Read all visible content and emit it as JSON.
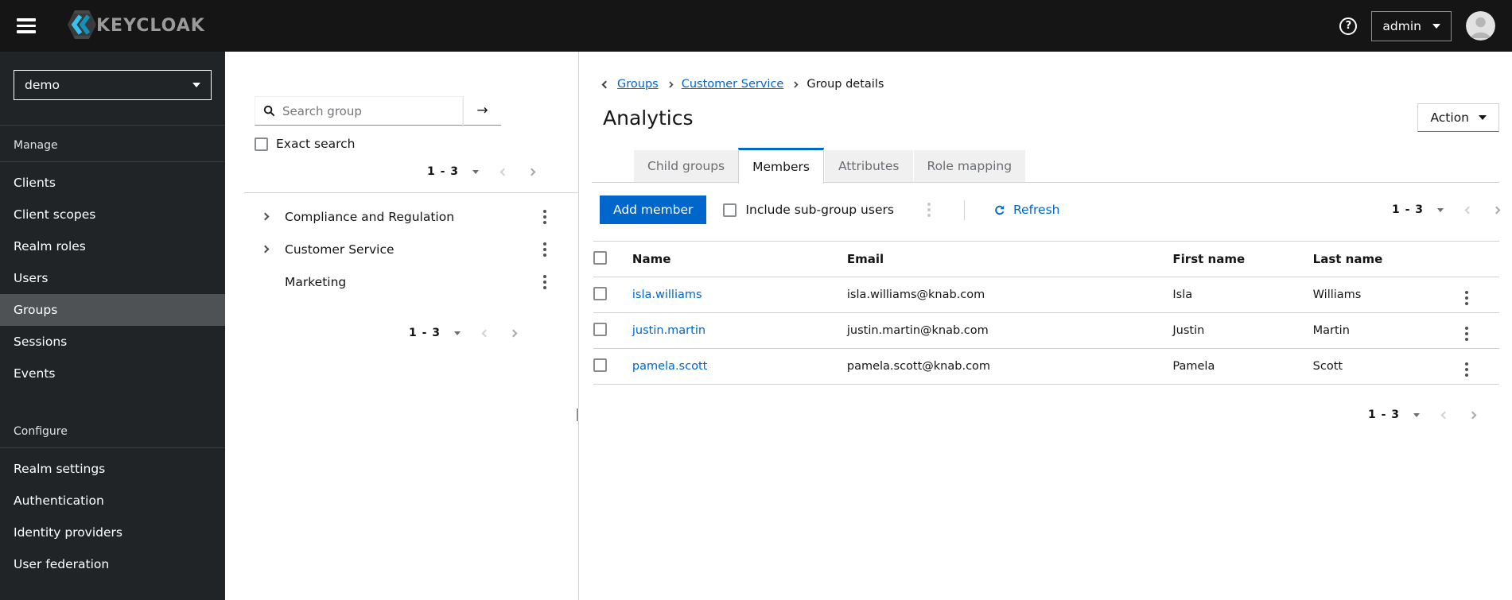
{
  "masthead": {
    "brand_text": "KEYCLOAK",
    "help_symbol": "?",
    "username": "admin"
  },
  "sidebar": {
    "realm_name": "demo",
    "sections": [
      {
        "label": "Manage",
        "items": [
          {
            "label": "Clients"
          },
          {
            "label": "Client scopes"
          },
          {
            "label": "Realm roles"
          },
          {
            "label": "Users"
          },
          {
            "label": "Groups",
            "active": true
          },
          {
            "label": "Sessions"
          },
          {
            "label": "Events"
          }
        ]
      },
      {
        "label": "Configure",
        "items": [
          {
            "label": "Realm settings"
          },
          {
            "label": "Authentication"
          },
          {
            "label": "Identity providers"
          },
          {
            "label": "User federation"
          }
        ]
      }
    ]
  },
  "groups_panel": {
    "search_placeholder": "Search group",
    "search_submit_icon": "→",
    "exact_search_label": "Exact search",
    "top_pagination": {
      "range": "1 - 3"
    },
    "tree_items": [
      {
        "label": "Compliance and Regulation",
        "expandable": true
      },
      {
        "label": "Customer Service",
        "expandable": true
      },
      {
        "label": "Marketing",
        "expandable": false
      }
    ],
    "bottom_pagination": {
      "range": "1 - 3"
    }
  },
  "content": {
    "breadcrumb": {
      "items": [
        {
          "label": "Groups"
        },
        {
          "label": "Customer Service"
        },
        {
          "label": "Group details"
        }
      ]
    },
    "page_title": "Analytics",
    "action_button_label": "Action",
    "tabs": [
      {
        "label": "Child groups"
      },
      {
        "label": "Members",
        "active": true
      },
      {
        "label": "Attributes"
      },
      {
        "label": "Role mapping"
      }
    ],
    "toolbar": {
      "add_member_label": "Add member",
      "include_subgroups_label": "Include sub-group users",
      "refresh_label": "Refresh",
      "pagination": {
        "range": "1 - 3"
      }
    },
    "members_table": {
      "columns": [
        "Name",
        "Email",
        "First name",
        "Last name"
      ],
      "rows": [
        {
          "username": "isla.williams",
          "email": "isla.williams@knab.com",
          "first_name": "Isla",
          "last_name": "Williams"
        },
        {
          "username": "justin.martin",
          "email": "justin.martin@knab.com",
          "first_name": "Justin",
          "last_name": "Martin"
        },
        {
          "username": "pamela.scott",
          "email": "pamela.scott@knab.com",
          "first_name": "Pamela",
          "last_name": "Scott"
        }
      ]
    },
    "bottom_pagination": {
      "range": "1 - 3"
    }
  },
  "colors": {
    "accent_blue": "#0066cc",
    "masthead_bg": "#151515",
    "sidebar_bg": "#212427",
    "sidebar_active_bg": "#4f5255",
    "tab_inactive_bg": "#f0f0f0",
    "border": "#d2d2d2",
    "muted_text": "#6a6e73"
  }
}
